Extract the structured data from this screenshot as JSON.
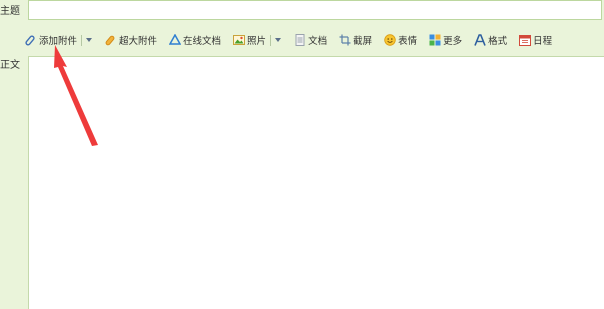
{
  "form": {
    "subject_label": "主题",
    "subject_value": "",
    "body_label": "正文",
    "body_value": ""
  },
  "toolbar": {
    "items": [
      {
        "label": "添加附件",
        "icon": "paperclip-icon",
        "has_dropdown": true
      },
      {
        "label": "超大附件",
        "icon": "paperclip-icon"
      },
      {
        "label": "在线文档",
        "icon": "drive-icon"
      },
      {
        "label": "照片",
        "icon": "photo-icon",
        "has_dropdown": true
      },
      {
        "label": "文档",
        "icon": "document-icon"
      },
      {
        "label": "截屏",
        "icon": "screenshot-icon"
      },
      {
        "label": "表情",
        "icon": "emoji-icon"
      },
      {
        "label": "更多",
        "icon": "more-icon"
      },
      {
        "label": "格式",
        "icon": "format-icon"
      },
      {
        "label": "日程",
        "icon": "calendar-icon"
      }
    ]
  },
  "colors": {
    "background": "#eaf4da",
    "input_border": "#bcd79f",
    "arrow": "#ee3b3b"
  }
}
